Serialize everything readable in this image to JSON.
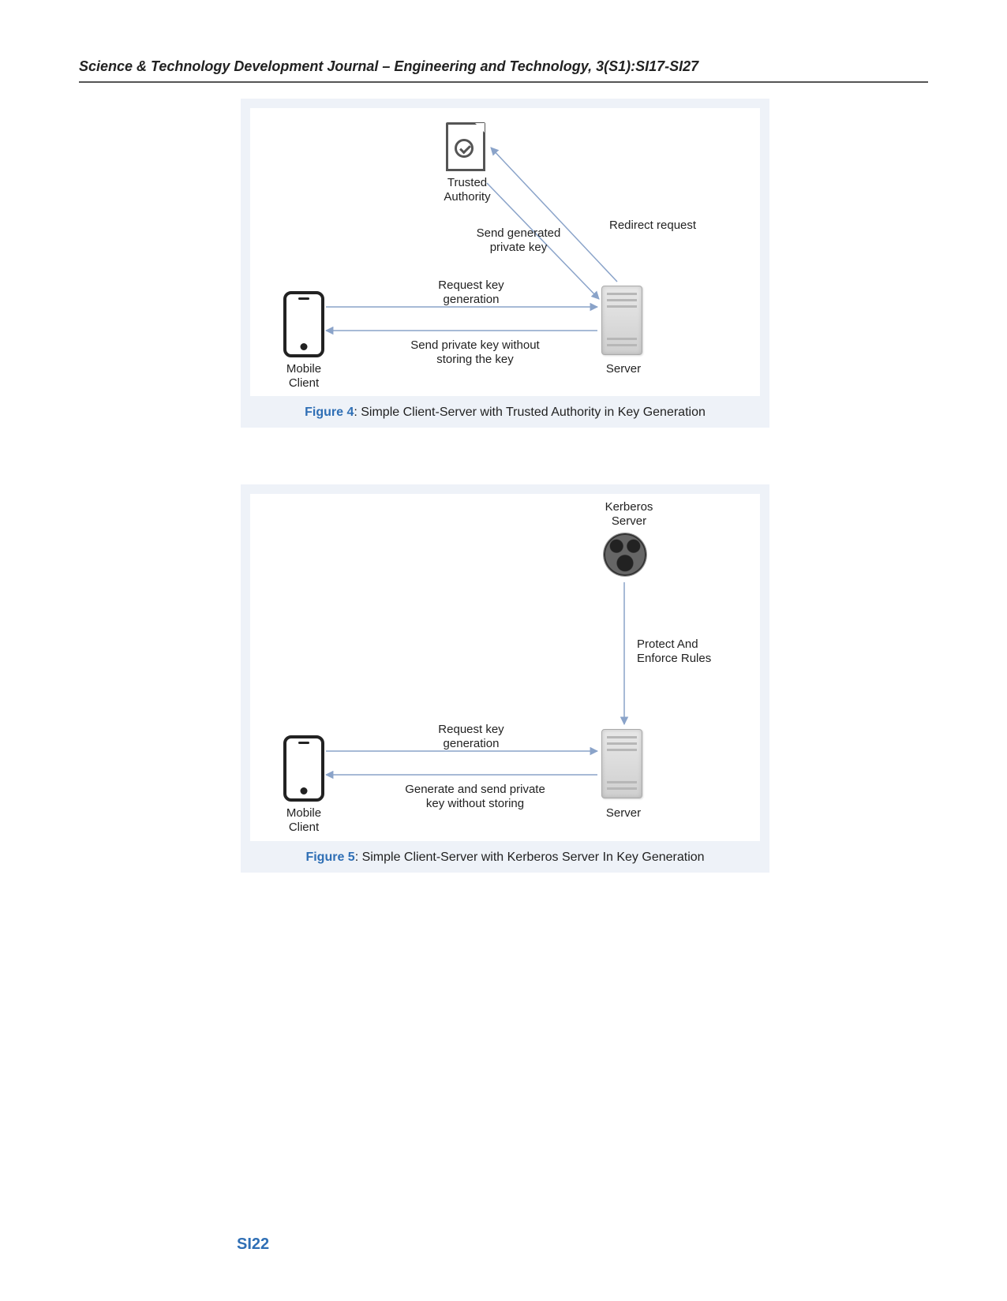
{
  "header": {
    "running_head": "Science & Technology Development Journal – Engineering and Technology, 3(S1):SI17-SI27"
  },
  "page_number": "SI22",
  "figure4": {
    "caption_label": "Figure 4",
    "caption_text": ": Simple Client-Server with Trusted Authority in Key Generation",
    "nodes": {
      "trusted_authority": "Trusted\nAuthority",
      "mobile_client": "Mobile\nClient",
      "server": "Server"
    },
    "arrows": {
      "redirect_request": "Redirect request",
      "send_generated_private_key": "Send generated\nprivate key",
      "request_key_generation": "Request key\ngeneration",
      "send_private_key_without_storing": "Send private key without\nstoring the key"
    }
  },
  "figure5": {
    "caption_label": "Figure 5",
    "caption_text": ": Simple Client-Server with Kerberos Server In Key Generation",
    "nodes": {
      "kerberos_server": "Kerberos\nServer",
      "mobile_client": "Mobile\nClient",
      "server": "Server"
    },
    "arrows": {
      "protect_and_enforce_rules": "Protect And\nEnforce Rules",
      "request_key_generation": "Request key\ngeneration",
      "generate_and_send_private_key": "Generate and send private\nkey without storing"
    }
  }
}
